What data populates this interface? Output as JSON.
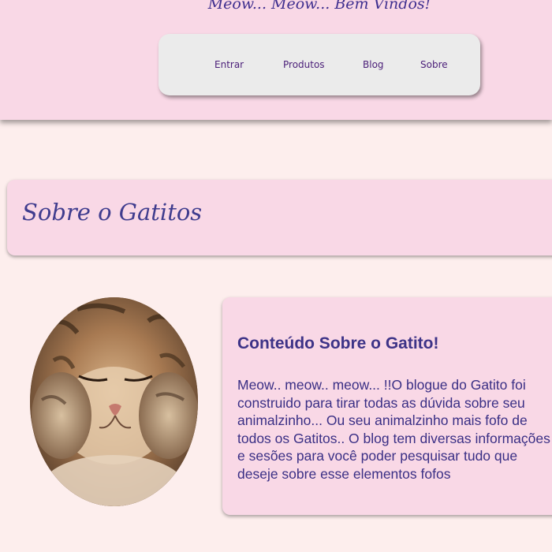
{
  "header": {
    "welcome": "Meow... Meow... Bem Vindos!",
    "nav": [
      {
        "label": "Entrar"
      },
      {
        "label": "Produtos"
      },
      {
        "label": "Blog"
      },
      {
        "label": "Sobre"
      }
    ]
  },
  "section": {
    "title": "Sobre o Gatitos"
  },
  "content": {
    "image_alt": "cat-photo",
    "card_title": "Conteúdo Sobre o Gatito!",
    "card_text": "Meow.. meow.. meow... !!O blogue do Gatito foi construido para tirar todas as dúvida sobre seu animalzinho... Ou seu animalzinho mais fofo de todos os Gatitos.. O blog tem diversas informações e sesões para você poder pesquisar tudo que deseje sobre esse elementos fofos"
  },
  "colors": {
    "page_background": "#fdeeed",
    "header_background": "#f9d8e6",
    "nav_background": "#ebebeb",
    "accent_text": "#3f3c8e"
  }
}
